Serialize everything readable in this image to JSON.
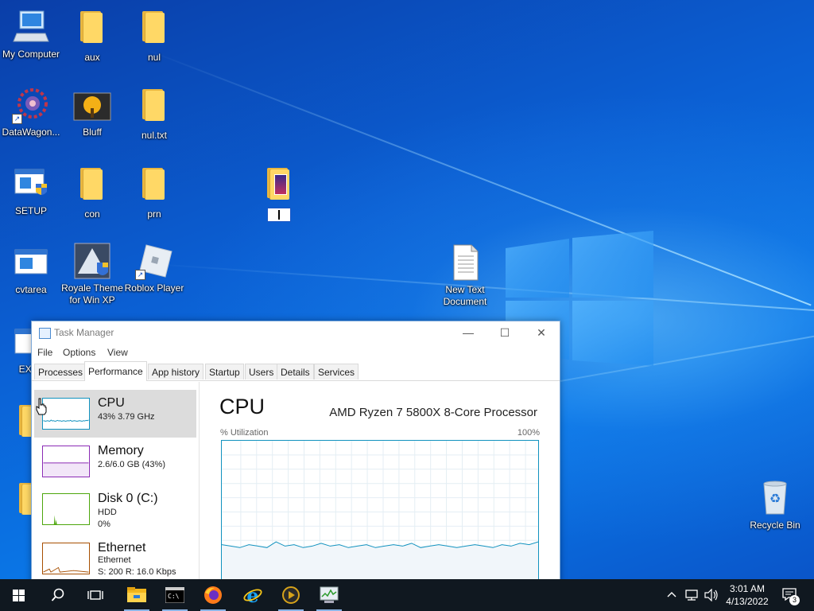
{
  "desktop": {
    "icons": [
      {
        "label": "My Computer",
        "icon": "computer-icon"
      },
      {
        "label": "aux",
        "icon": "folder-icon"
      },
      {
        "label": "nul",
        "icon": "folder-icon"
      },
      {
        "label": "DataWagon...",
        "icon": "gear-shortcut-icon"
      },
      {
        "label": "Bluff",
        "icon": "tree-image-icon"
      },
      {
        "label": "nul.txt",
        "icon": "folder-icon"
      },
      {
        "label": "SETUP",
        "icon": "installer-icon"
      },
      {
        "label": "con",
        "icon": "folder-icon"
      },
      {
        "label": "prn",
        "icon": "folder-icon"
      },
      {
        "label": "",
        "icon": "media-folder-icon"
      },
      {
        "label": "cvtarea",
        "icon": "window-icon"
      },
      {
        "label": "Royale Theme for Win XP",
        "icon": "royale-installer-icon"
      },
      {
        "label": "Roblox Player",
        "icon": "roblox-icon"
      },
      {
        "label": "New Text Document",
        "icon": "text-document-icon"
      },
      {
        "label": "EXPL",
        "icon": "window-icon"
      },
      {
        "label": "Recycle Bin",
        "icon": "recycle-bin-icon"
      }
    ]
  },
  "task_manager": {
    "title": "Task Manager",
    "menu": [
      "File",
      "Options",
      "View"
    ],
    "tabs": [
      "Processes",
      "Performance",
      "App history",
      "Startup",
      "Users",
      "Details",
      "Services"
    ],
    "active_tab": "Performance",
    "resources": [
      {
        "name": "CPU",
        "lines": [
          "43%  3.79 GHz"
        ],
        "color": "#1192bf",
        "selected": true
      },
      {
        "name": "Memory",
        "lines": [
          "2.6/6.0 GB (43%)"
        ],
        "color": "#8b2bb5"
      },
      {
        "name": "Disk 0 (C:)",
        "lines": [
          "HDD",
          "0%"
        ],
        "color": "#4da60c"
      },
      {
        "name": "Ethernet",
        "lines": [
          "Ethernet",
          "S: 200  R: 16.0 Kbps"
        ],
        "color": "#a74f01"
      }
    ],
    "detail": {
      "title": "CPU",
      "processor": "AMD Ryzen 7 5800X 8-Core Processor",
      "y_label": "% Utilization",
      "y_max_label": "100%",
      "utilization_series": [
        27,
        26,
        25,
        27,
        26,
        25,
        29,
        26,
        27,
        25,
        26,
        28,
        26,
        27,
        25,
        26,
        27,
        25,
        26,
        27,
        26,
        28,
        25,
        26,
        27,
        26,
        25,
        26,
        27,
        26,
        25,
        27,
        26,
        28,
        27,
        29
      ]
    }
  },
  "taskbar": {
    "apps": [
      "start-icon",
      "search-icon",
      "task-view-icon",
      "file-explorer-icon",
      "command-prompt-icon",
      "firefox-icon",
      "internet-explorer-icon",
      "media-player-icon",
      "task-manager-icon"
    ],
    "time": "3:01 AM",
    "date": "4/13/2022",
    "notification_count": "3"
  }
}
